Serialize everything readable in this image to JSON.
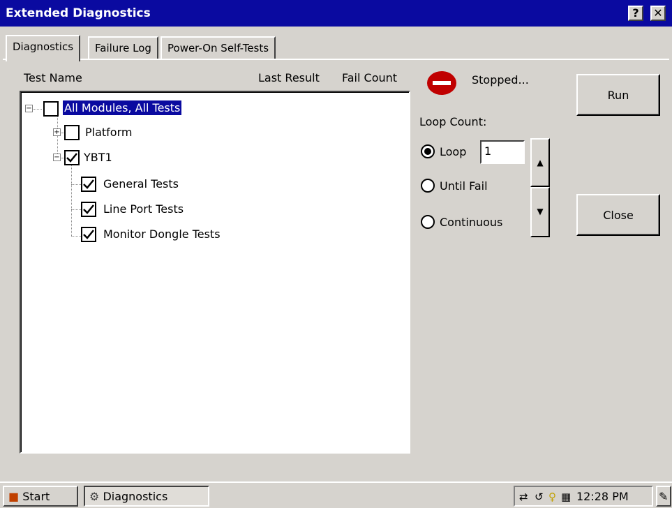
{
  "window": {
    "title": "Extended Diagnostics",
    "help_label": "?",
    "close_label": "✕"
  },
  "tabs": [
    {
      "label": "Diagnostics",
      "active": true
    },
    {
      "label": "Failure Log",
      "active": false
    },
    {
      "label": "Power-On Self-Tests",
      "active": false
    }
  ],
  "columns": {
    "test_name": "Test Name",
    "last_result": "Last Result",
    "fail_count": "Fail Count"
  },
  "tree": [
    {
      "label": "All Modules, All Tests",
      "checked": false,
      "expanded": true,
      "selected": true
    },
    {
      "label": "Platform",
      "checked": false,
      "expanded": false
    },
    {
      "label": "YBT1",
      "checked": true,
      "expanded": true
    },
    {
      "label": "General Tests",
      "checked": true
    },
    {
      "label": "Line Port Tests",
      "checked": true
    },
    {
      "label": "Monitor Dongle Tests",
      "checked": true
    }
  ],
  "status": {
    "icon": "stop-icon",
    "text": "Stopped...",
    "color": "#c00000"
  },
  "buttons": {
    "run": "Run",
    "close": "Close"
  },
  "loop": {
    "label": "Loop Count:",
    "options": [
      {
        "label": "Loop",
        "selected": true
      },
      {
        "label": "Until Fail",
        "selected": false
      },
      {
        "label": "Continuous",
        "selected": false
      }
    ],
    "value": "1"
  },
  "taskbar": {
    "start_label": "Start",
    "app_label": "Diagnostics",
    "clock": "12:28 PM"
  },
  "colors": {
    "titlebar": "#0a0aa0",
    "face": "#d6d3ce",
    "selection": "#0a0aa0"
  }
}
